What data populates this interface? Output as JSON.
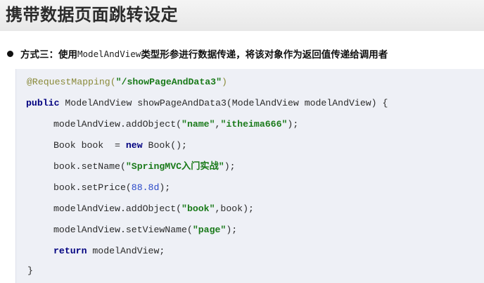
{
  "header": {
    "title": "携带数据页面跳转设定"
  },
  "bullet": {
    "prefix": "方式三：使用",
    "code": "ModelAndView",
    "suffix": "类型形参进行数据传递，将该对象作为返回值传递给调用者"
  },
  "code": {
    "annotation": "@RequestMapping(",
    "mapping_value": "\"/showPageAndData3\"",
    "annotation_close": ")",
    "kw_public": "public",
    "signature": " ModelAndView showPageAndData3(ModelAndView modelAndView) {",
    "l3_a": "modelAndView.addObject(",
    "l3_key": "\"name\"",
    "l3_comma": ",",
    "l3_val": "\"itheima666\"",
    "l3_b": ");",
    "l4_a": "Book book  = ",
    "kw_new": "new",
    "l4_b": " Book();",
    "l5_a": "book.setName(",
    "l5_val": "\"SpringMVC入门实战\"",
    "l5_b": ");",
    "l6_a": "book.setPrice(",
    "l6_num": "88.8d",
    "l6_b": ");",
    "l7_a": "modelAndView.addObject(",
    "l7_key": "\"book\"",
    "l7_b": ",book);",
    "l8_a": "modelAndView.setViewName(",
    "l8_val": "\"page\"",
    "l8_b": ");",
    "kw_return": "return",
    "l9_b": " modelAndView;",
    "closing": "}"
  },
  "colors": {
    "annotation": "#8a8a3a",
    "keyword": "#000080",
    "string": "#1a7a1a",
    "number": "#2a48c8",
    "code_background": "#eef0f6"
  }
}
